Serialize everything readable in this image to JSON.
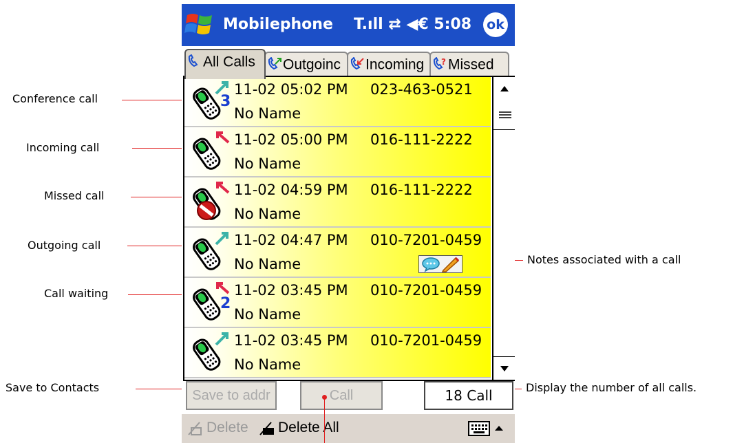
{
  "window": {
    "title": "Mobilephone",
    "status": "T.ıll ⇄ ◀€ 5:08",
    "ok_label": "ok"
  },
  "tabs": [
    {
      "label": "All Calls",
      "active": true
    },
    {
      "label": "Outgoinc",
      "active": false
    },
    {
      "label": "Incoming",
      "active": false
    },
    {
      "label": "Missed",
      "active": false
    }
  ],
  "calls": [
    {
      "type": "conference",
      "badge": "3",
      "datetime": "11-02 05:02 PM",
      "number": "023-463-0521",
      "name": "No Name",
      "has_note": false
    },
    {
      "type": "incoming",
      "badge": "",
      "datetime": "11-02 05:00 PM",
      "number": "016-111-2222",
      "name": "No Name",
      "has_note": false
    },
    {
      "type": "missed",
      "badge": "",
      "datetime": "11-02 04:59 PM",
      "number": "016-111-2222",
      "name": "No Name",
      "has_note": false
    },
    {
      "type": "outgoing",
      "badge": "",
      "datetime": "11-02 04:47 PM",
      "number": "010-7201-0459",
      "name": "No Name",
      "has_note": true
    },
    {
      "type": "waiting",
      "badge": "2",
      "datetime": "11-02 03:45 PM",
      "number": "010-7201-0459",
      "name": "No Name",
      "has_note": false
    },
    {
      "type": "outgoing",
      "badge": "",
      "datetime": "11-02 03:45 PM",
      "number": "010-7201-0459",
      "name": "No Name",
      "has_note": false
    }
  ],
  "buttons": {
    "save_to_addr": "Save to addr",
    "call": "Call",
    "count": "18 Call"
  },
  "menubar": {
    "delete": "Delete",
    "delete_all": "Delete All"
  },
  "callouts": {
    "conference": "Conference call",
    "incoming": "Incoming call",
    "missed": "Missed call",
    "outgoing": "Outgoing call",
    "waiting": "Call waiting",
    "save_contacts": "Save to Contacts",
    "notes": "Notes associated with a call",
    "count": "Display the number of all calls."
  },
  "colors": {
    "titlebar": "#1c4fc7",
    "row_gradient_end": "#ffff00",
    "callout_line": "#e02020"
  }
}
